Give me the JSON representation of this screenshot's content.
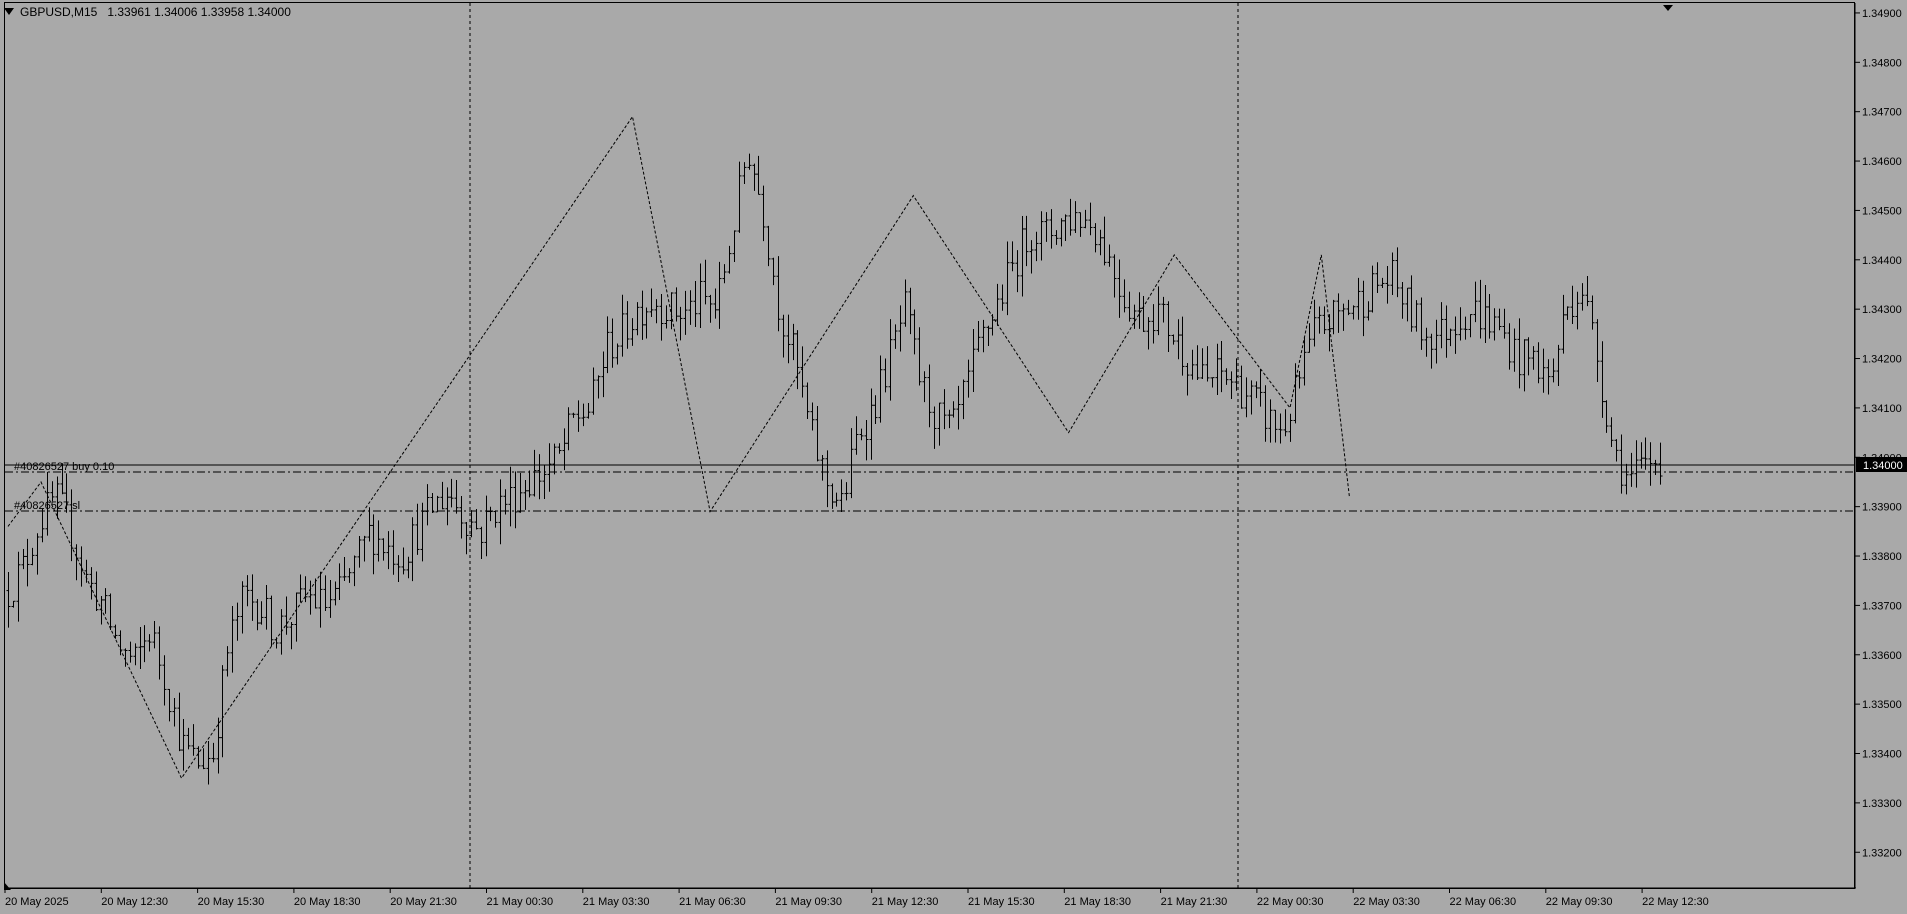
{
  "header": {
    "symbol_timeframe": "GBPUSD,M15",
    "ohlc": "1.33961 1.34006 1.33958 1.34000"
  },
  "colors": {
    "background": "#a9a9a9",
    "bars": "#000000",
    "current_price_bg": "#000000",
    "current_price_text": "#ffffff"
  },
  "chart_data": {
    "type": "ohlc",
    "symbol": "GBPUSD",
    "timeframe": "M15",
    "ylim": [
      1.3316,
      1.3491
    ],
    "y_ticks": [
      "1.34900",
      "1.34800",
      "1.34700",
      "1.34600",
      "1.34500",
      "1.34400",
      "1.34300",
      "1.34200",
      "1.34100",
      "1.34000",
      "1.33900",
      "1.33800",
      "1.33700",
      "1.33600",
      "1.33500",
      "1.33400",
      "1.33300",
      "1.33200"
    ],
    "x_ticks": [
      "20 May 2025",
      "20 May 12:30",
      "20 May 15:30",
      "20 May 18:30",
      "20 May 21:30",
      "21 May 00:30",
      "21 May 03:30",
      "21 May 06:30",
      "21 May 09:30",
      "21 May 12:30",
      "21 May 15:30",
      "21 May 18:30",
      "21 May 21:30",
      "22 May 00:30",
      "22 May 03:30",
      "22 May 06:30",
      "22 May 09:30",
      "22 May 12:30"
    ],
    "current_price": "1.34000",
    "current_price_value": 1.34,
    "trade_lines": [
      {
        "label": "#40826527 buy 0.10",
        "price": 1.33985
      },
      {
        "label": "#40826527 sl",
        "price": 1.33908
      }
    ],
    "day_separators": [
      "21 May 00:00",
      "22 May 00:00"
    ],
    "zigzag": [
      1.3386,
      1.3395,
      1.3335,
      1.3469,
      1.3389,
      1.3453,
      1.3405,
      1.3441,
      1.341,
      1.3441,
      1.3392
    ],
    "bars_close_approx": [
      1.3373,
      1.3378,
      1.3387,
      1.3392,
      1.3385,
      1.3375,
      1.337,
      1.3362,
      1.3358,
      1.3365,
      1.3355,
      1.3342,
      1.3338,
      1.334,
      1.3362,
      1.3372,
      1.337,
      1.3365,
      1.3368,
      1.3372,
      1.337,
      1.3372,
      1.3378,
      1.3385,
      1.3382,
      1.338,
      1.3385,
      1.339,
      1.3393,
      1.3388,
      1.3385,
      1.339,
      1.3392,
      1.3395,
      1.3397,
      1.34,
      1.3408,
      1.341,
      1.3422,
      1.3425,
      1.343,
      1.3432,
      1.343,
      1.3429,
      1.3432,
      1.343,
      1.3445,
      1.3463,
      1.345,
      1.343,
      1.342,
      1.3405,
      1.3395,
      1.339,
      1.3405,
      1.341,
      1.342,
      1.343,
      1.3415,
      1.3408,
      1.3405,
      1.3415,
      1.3425,
      1.3432,
      1.344,
      1.3446,
      1.3445,
      1.3448,
      1.3449,
      1.3447,
      1.344,
      1.3432,
      1.3428,
      1.343,
      1.3425,
      1.342,
      1.3415,
      1.3417,
      1.3415,
      1.3412,
      1.3408,
      1.3405,
      1.3415,
      1.3425,
      1.3428,
      1.343,
      1.3432,
      1.3435,
      1.3436,
      1.343,
      1.3425,
      1.3425,
      1.3428,
      1.343,
      1.3428,
      1.3425,
      1.342,
      1.342,
      1.3415,
      1.343,
      1.3435,
      1.342,
      1.3402,
      1.3395,
      1.3398,
      1.34
    ]
  }
}
